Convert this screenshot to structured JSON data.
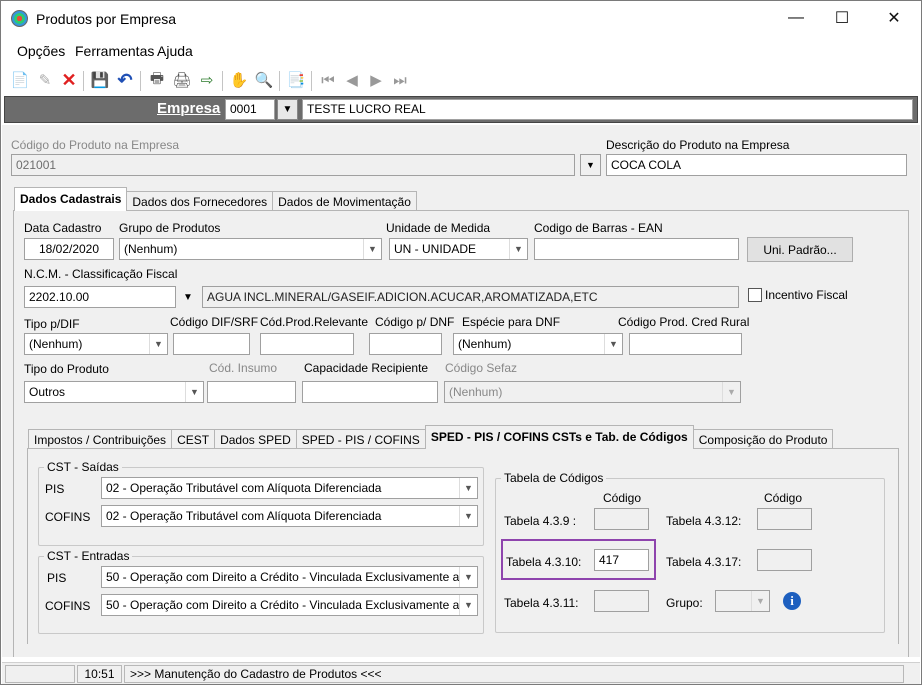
{
  "window": {
    "title": "Produtos por Empresa",
    "minimize": "—",
    "maximize": "☐",
    "close": "✕"
  },
  "menu": [
    "Opções",
    "Ferramentas",
    "Ajuda"
  ],
  "toolbar_icons": [
    "new-icon",
    "edit-icon",
    "delete-icon",
    "save-icon",
    "undo-icon",
    "print-icon",
    "print-preview-icon",
    "export-icon",
    "hand-icon",
    "search-icon",
    "report-icon",
    "first-record-icon",
    "prev-record-icon",
    "next-record-icon",
    "last-record-icon"
  ],
  "empresa": {
    "label": "Empresa",
    "code": "0001",
    "name": "TESTE LUCRO REAL"
  },
  "produto": {
    "codigo_label": "Código do Produto na Empresa",
    "codigo": "021001",
    "descricao_label": "Descrição do Produto na Empresa",
    "descricao": "COCA COLA"
  },
  "tabs": [
    "Dados Cadastrais",
    "Dados dos Fornecedores",
    "Dados de Movimentação"
  ],
  "cad": {
    "data_label": "Data Cadastro",
    "data": "18/02/2020",
    "grupo_label": "Grupo de Produtos",
    "grupo": "(Nenhum)",
    "unidade_label": "Unidade de Medida",
    "unidade": "UN - UNIDADE",
    "ean_label": "Codigo de Barras - EAN",
    "ean": "",
    "uni_btn": "Uni. Padrão...",
    "ncm_label": "N.C.M. -  Classificação Fiscal",
    "ncm": "2202.10.00",
    "ncm_desc": "AGUA INCL.MINERAL/GASEIF.ADICION.ACUCAR,AROMATIZADA,ETC",
    "incentivo_label": "Incentivo Fiscal",
    "tipo_dif_label": "Tipo p/DIF",
    "tipo_dif": "(Nenhum)",
    "cod_dif_label": "Código DIF/SRF",
    "cod_rel_label": "Cód.Prod.Relevante",
    "cod_dnf_label": "Código p/ DNF",
    "esp_dnf_label": "Espécie para DNF",
    "esp_dnf": "(Nenhum)",
    "cred_rural_label": "Código Prod. Cred Rural",
    "tipo_prod_label": "Tipo do Produto",
    "tipo_prod": "Outros",
    "insumo_label": "Cód. Insumo",
    "cap_label": "Capacidade Recipiente",
    "sefaz_label": "Código Sefaz",
    "sefaz": "(Nenhum)"
  },
  "subtabs": [
    "Impostos / Contribuições",
    "CEST",
    "Dados SPED",
    "SPED - PIS / COFINS",
    "SPED - PIS / COFINS CSTs e Tab. de Códigos",
    "Composição do Produto"
  ],
  "cst": {
    "saidas_title": "CST - Saídas",
    "entradas_title": "CST - Entradas",
    "pis_label": "PIS",
    "cofins_label": "COFINS",
    "saidas_pis": "02 - Operação Tributável com Alíquota Diferenciada",
    "saidas_cofins": "02 - Operação Tributável com Alíquota Diferenciada",
    "entradas_pis": "50 - Operação com Direito a Crédito - Vinculada Exclusivamente a",
    "entradas_cofins": "50 - Operação com Direito a Crédito - Vinculada Exclusivamente a"
  },
  "tabela": {
    "title": "Tabela de Códigos",
    "codigo_header": "Código",
    "t439": "Tabela 4.3.9 :",
    "t4312": "Tabela 4.3.12:",
    "t4310": "Tabela 4.3.10:",
    "t4310_value": "417",
    "t4317": "Tabela 4.3.17:",
    "t4311": "Tabela 4.3.11:",
    "grupo": "Grupo:"
  },
  "status": {
    "time": "10:51",
    "message": ">>> Manutenção do Cadastro de Produtos <<<"
  },
  "colors": {
    "highlight": "#8e44ad",
    "info": "#1d5fbf",
    "empresa_bar": "#6c6c6c"
  }
}
